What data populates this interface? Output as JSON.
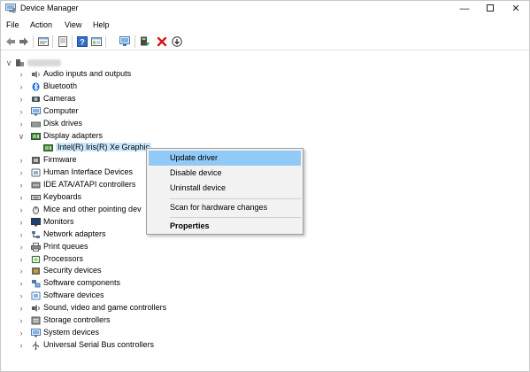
{
  "window": {
    "title": "Device Manager",
    "title_icon": "device-manager-icon"
  },
  "window_controls": {
    "minimize": "—",
    "close": "✕"
  },
  "menu": {
    "items": [
      "File",
      "Action",
      "View",
      "Help"
    ]
  },
  "toolbar": {
    "icons": [
      "back-arrow-icon",
      "forward-arrow-icon",
      "properties-icon",
      "show-hidden-icon",
      "help-icon",
      "action-view-icon",
      "scan-hardware-icon",
      "update-driver-icon",
      "uninstall-icon",
      "disable-icon"
    ]
  },
  "tree": {
    "root_expander": "∨",
    "items": [
      {
        "label": "Audio inputs and outputs",
        "icon": "speaker-icon",
        "expander": "›"
      },
      {
        "label": "Bluetooth",
        "icon": "bluetooth-icon",
        "expander": "›"
      },
      {
        "label": "Cameras",
        "icon": "camera-icon",
        "expander": "›"
      },
      {
        "label": "Computer",
        "icon": "computer-icon",
        "expander": "›"
      },
      {
        "label": "Disk drives",
        "icon": "disk-icon",
        "expander": "›"
      },
      {
        "label": "Display adapters",
        "icon": "display-adapter-icon",
        "expander": "∨"
      },
      {
        "label": "Intel(R) Iris(R) Xe Graphic",
        "icon": "display-adapter-icon",
        "expander": ""
      },
      {
        "label": "Firmware",
        "icon": "firmware-icon",
        "expander": "›"
      },
      {
        "label": "Human Interface Devices",
        "icon": "hid-icon",
        "expander": "›"
      },
      {
        "label": "IDE ATA/ATAPI controllers",
        "icon": "ide-icon",
        "expander": "›"
      },
      {
        "label": "Keyboards",
        "icon": "keyboard-icon",
        "expander": "›"
      },
      {
        "label": "Mice and other pointing dev",
        "icon": "mouse-icon",
        "expander": "›"
      },
      {
        "label": "Monitors",
        "icon": "monitor-icon",
        "expander": "›"
      },
      {
        "label": "Network adapters",
        "icon": "network-icon",
        "expander": "›"
      },
      {
        "label": "Print queues",
        "icon": "printer-icon",
        "expander": "›"
      },
      {
        "label": "Processors",
        "icon": "processor-icon",
        "expander": "›"
      },
      {
        "label": "Security devices",
        "icon": "security-icon",
        "expander": "›"
      },
      {
        "label": "Software components",
        "icon": "software-component-icon",
        "expander": "›"
      },
      {
        "label": "Software devices",
        "icon": "software-device-icon",
        "expander": "›"
      },
      {
        "label": "Sound, video and game controllers",
        "icon": "sound-icon",
        "expander": "›"
      },
      {
        "label": "Storage controllers",
        "icon": "storage-icon",
        "expander": "›"
      },
      {
        "label": "System devices",
        "icon": "system-icon",
        "expander": "›"
      },
      {
        "label": "Universal Serial Bus controllers",
        "icon": "usb-icon",
        "expander": "›"
      }
    ]
  },
  "context_menu": {
    "items": [
      "Update driver",
      "Disable device",
      "Uninstall device",
      "Scan for hardware changes",
      "Properties"
    ],
    "highlighted": "Update driver"
  },
  "colors": {
    "highlight": "#91c9f7",
    "selection": "#cce8ff",
    "menu_bg": "#f2f2f2"
  }
}
